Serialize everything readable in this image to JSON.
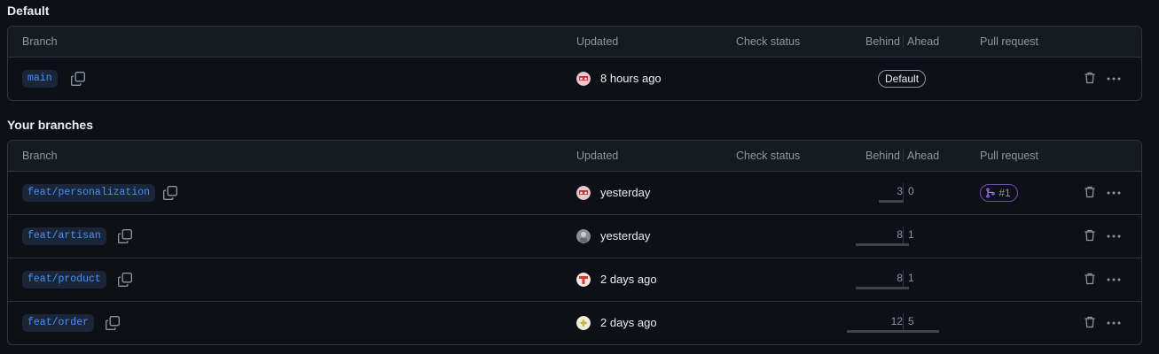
{
  "sections": {
    "default": {
      "title": "Default",
      "headers": {
        "branch": "Branch",
        "updated": "Updated",
        "check_status": "Check status",
        "behind": "Behind",
        "ahead": "Ahead",
        "pull_request": "Pull request"
      },
      "rows": [
        {
          "branch": "main",
          "updated": "8 hours ago",
          "badge": "Default"
        }
      ]
    },
    "yours": {
      "title": "Your branches",
      "headers": {
        "branch": "Branch",
        "updated": "Updated",
        "check_status": "Check status",
        "behind": "Behind",
        "ahead": "Ahead",
        "pull_request": "Pull request"
      },
      "rows": [
        {
          "branch": "feat/personalization",
          "updated": "yesterday",
          "behind": "3",
          "ahead": "0",
          "pr": "#1"
        },
        {
          "branch": "feat/artisan",
          "updated": "yesterday",
          "behind": "8",
          "ahead": "1"
        },
        {
          "branch": "feat/product",
          "updated": "2 days ago",
          "behind": "8",
          "ahead": "1"
        },
        {
          "branch": "feat/order",
          "updated": "2 days ago",
          "behind": "12",
          "ahead": "5"
        }
      ]
    }
  },
  "icons": {
    "copy": "copy-icon",
    "trash": "trash-icon",
    "more": "kebab-horizontal-icon",
    "pr": "git-pull-request-icon"
  },
  "colors": {
    "background": "#0d1117",
    "header_bg": "#161b22",
    "border": "#30363d",
    "branch_text": "#4493f8",
    "branch_bg": "#1a2638",
    "muted": "#8d96a0",
    "pr_border": "#6e4bb8",
    "pr_icon": "#a371f7"
  }
}
